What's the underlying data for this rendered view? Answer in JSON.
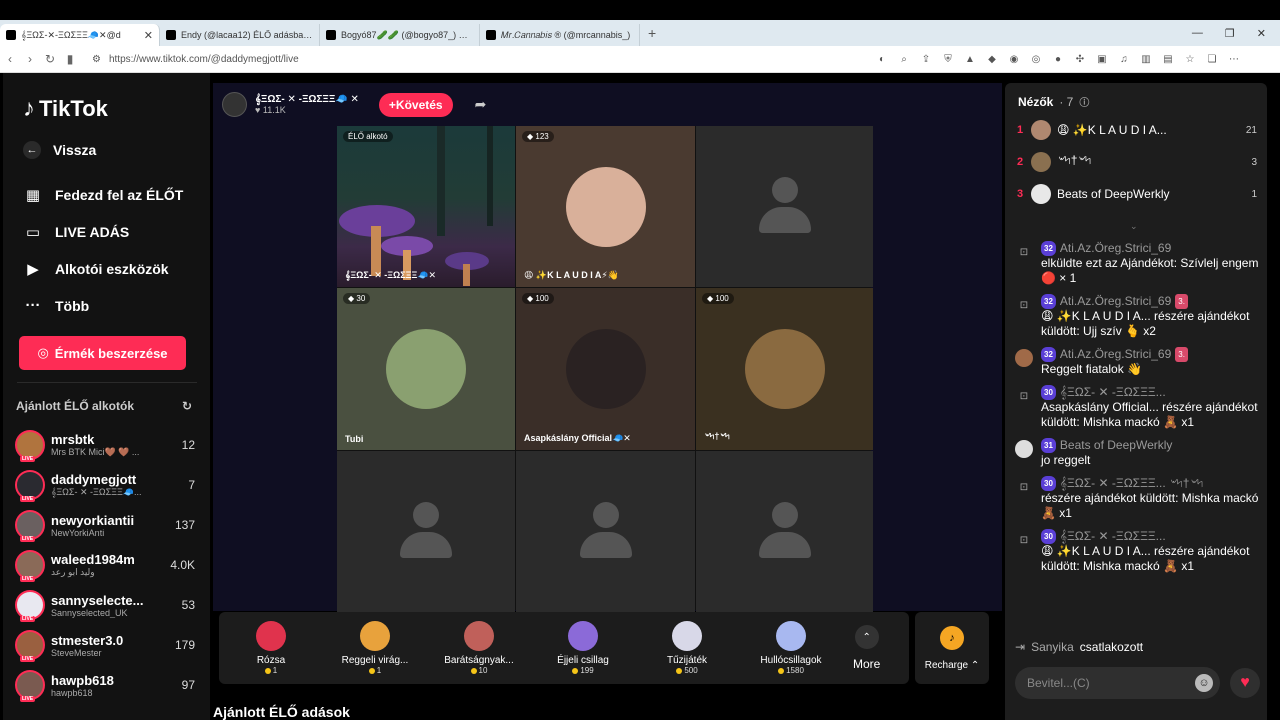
{
  "browser": {
    "tabs": [
      {
        "title": "𝄞ΞΩΣ-✕-ΞΩΣΞΞ🧢✕@d",
        "active": true
      },
      {
        "title": "Endy (@lacaa12) ÉLŐ adásban va",
        "active": false
      },
      {
        "title": "Bogyó87🥒🥒 (@bogyo87_) ÉLŐ a",
        "active": false
      },
      {
        "title": "𝑀𝑟.𝐶𝑎𝑛𝑛𝑎𝑏𝑖𝑠 ® (@mrcannabis_)",
        "active": false
      }
    ],
    "url": "https://www.tiktok.com/@daddymegjott/live"
  },
  "sidebar": {
    "logo": "TikTok",
    "back_label": "Vissza",
    "nav": [
      {
        "label": "Fedezd fel az ÉLŐT",
        "icon": "calendar-live-icon"
      },
      {
        "label": "LIVE ADÁS",
        "icon": "camera-icon"
      },
      {
        "label": "Alkotói eszközök",
        "icon": "play-square-icon"
      },
      {
        "label": "Több",
        "icon": "more-dots-icon"
      }
    ],
    "coin_button": "Érmék beszerzése",
    "recommended_title": "Ajánlott ÉLŐ alkotók",
    "creators": [
      {
        "name": "mrsbtk",
        "sub": "Mrs BTK Mici🤎 🤎 ...",
        "count": "12"
      },
      {
        "name": "daddymegjott",
        "sub": "𝄞ΞΩΣ- ✕ -ΞΩΣΞΞ🧢...",
        "count": "7"
      },
      {
        "name": "newyorkiantii",
        "sub": "NewYorkiAnti",
        "count": "137"
      },
      {
        "name": "waleed1984m",
        "sub": "وليد ابو رعد",
        "count": "4.0K"
      },
      {
        "name": "sannyselecte...",
        "sub": "Sannyselected_UK",
        "count": "53"
      },
      {
        "name": "stmester3.0",
        "sub": "SteveMester",
        "count": "179"
      },
      {
        "name": "hawpb618",
        "sub": "hawpb618",
        "count": "97"
      }
    ]
  },
  "stream": {
    "host_name": "𝄞ΞΩΣ- ✕ -ΞΩΣΞΞ🧢 ✕",
    "host_likes": "11.1K",
    "follow_label": "+Követés",
    "cells": [
      {
        "badge": "ÉLŐ alkotó",
        "name": "𝄞ΞΩΣ- ✕ -ΞΩΣΞΞ🧢✕"
      },
      {
        "badge": "123",
        "name": "😩 ✨K L A U D I A⚡👋"
      },
      {
        "badge": "",
        "name": ""
      },
      {
        "badge": "30",
        "name": "Tubi"
      },
      {
        "badge": "100",
        "name": "Asapkáslány Official🧢✕"
      },
      {
        "badge": "100",
        "name": "৺৸†৺৸"
      },
      {
        "badge": "",
        "name": ""
      },
      {
        "badge": "",
        "name": ""
      },
      {
        "badge": "",
        "name": ""
      }
    ],
    "gifts": [
      {
        "name": "Rózsa",
        "price": "1",
        "color": "#e0334d"
      },
      {
        "name": "Reggeli virág...",
        "price": "1",
        "color": "#e8a23c"
      },
      {
        "name": "Barátságnyak...",
        "price": "10",
        "color": "#c0605a"
      },
      {
        "name": "Éjjeli csillag",
        "price": "199",
        "color": "#8b6ad8"
      },
      {
        "name": "Tűzijáték",
        "price": "500",
        "color": "#d8d8e8"
      },
      {
        "name": "Hullócsillagok",
        "price": "1580",
        "color": "#a8b8f0"
      }
    ],
    "more_label": "More",
    "recharge_label": "Recharge",
    "recommended_live": "Ajánlott ÉLŐ adások"
  },
  "viewers": {
    "title": "Nézők",
    "count": "· 7",
    "list": [
      {
        "rank": "1",
        "name": "😩 ✨K L A U D I A...",
        "count": "21"
      },
      {
        "rank": "2",
        "name": "৺৸†৺৸",
        "count": "3"
      },
      {
        "rank": "3",
        "name": "Beats of DeepWerkly",
        "count": "1"
      }
    ]
  },
  "chat": {
    "messages": [
      {
        "icon": "gift-icon",
        "level": "32",
        "user": "Ati.Az.Öreg.Strici_69",
        "fan": "",
        "text": "elküldte ezt az Ajándékot: Szívlelj engem 🔴 × 1"
      },
      {
        "icon": "gift-icon",
        "level": "32",
        "user": "Ati.Az.Öreg.Strici_69",
        "fan": "3.",
        "text": "😩 ✨K L A U D I A... részére ajándékot küldött: Ujj szív 🫰 x2"
      },
      {
        "icon": "avatar",
        "level": "32",
        "user": "Ati.Az.Öreg.Strici_69",
        "fan": "3.",
        "text": "Reggelt fiatalok 👋"
      },
      {
        "icon": "gift-icon",
        "level": "30",
        "user": "𝄞ΞΩΣ- ✕ -ΞΩΣΞΞ...",
        "fan": "",
        "text": "Asapkáslány Official... részére ajándékot küldött: Mishka mackó 🧸 x1"
      },
      {
        "icon": "avatar",
        "level": "31",
        "user": "Beats of DeepWerkly",
        "fan": "",
        "text": "jo reggelt"
      },
      {
        "icon": "gift-icon",
        "level": "30",
        "user": "𝄞ΞΩΣ- ✕ -ΞΩΣΞΞ... ৺৸†৺৸",
        "fan": "",
        "text": "részére ajándékot küldött: Mishka mackó 🧸 x1"
      },
      {
        "icon": "gift-icon",
        "level": "30",
        "user": "𝄞ΞΩΣ- ✕ -ΞΩΣΞΞ...",
        "fan": "",
        "text": "😩 ✨K L A U D I A... részére ajándékot küldött: Mishka mackó 🧸 x1"
      }
    ],
    "joined_name": "Sanyika",
    "joined_text": "csatlakozott",
    "input_placeholder": "Bevitel...(C)"
  }
}
